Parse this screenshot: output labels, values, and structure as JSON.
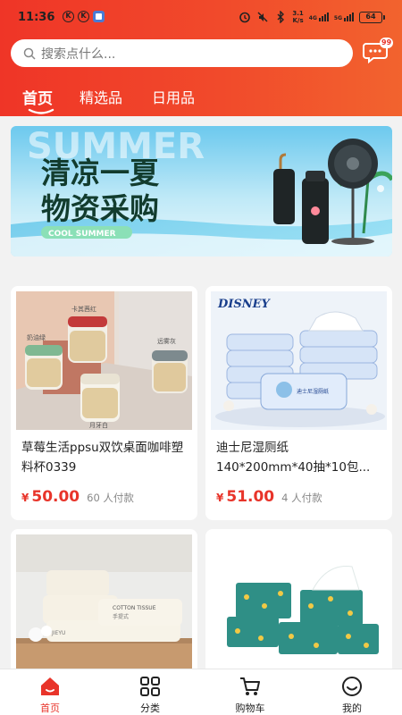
{
  "status_bar": {
    "time": "11:36",
    "speed_value": "3.1",
    "speed_unit": "K/s",
    "net1": "4G",
    "net2": "5G",
    "battery": "64"
  },
  "search": {
    "placeholder": "搜索点什么...",
    "message_badge": "99"
  },
  "tabs": [
    {
      "label": "首页",
      "active": true
    },
    {
      "label": "精选品",
      "active": false
    },
    {
      "label": "日用品",
      "active": false
    }
  ],
  "banner": {
    "headline_line1": "清凉一夏",
    "headline_line2": "物资采购",
    "tag": "COOL SUMMER",
    "bg_word": "SUMMER"
  },
  "products": [
    {
      "title": "草莓生活ppsu双饮桌面咖啡塑料杯0339",
      "currency": "¥",
      "price": "50.00",
      "sold": "60 人付款",
      "image_labels": [
        "奶油绿",
        "卡其茜红",
        "远雾灰",
        "月牙白"
      ]
    },
    {
      "title": "迪士尼湿厕纸140*200mm*40抽*10包...",
      "currency": "¥",
      "price": "51.00",
      "sold": "4 人付款",
      "brand_logo": "DISNEY",
      "pack_text": "迪士尼湿厕纸"
    },
    {
      "title": "",
      "pack_text": "COTTON TISSUE",
      "pack_sub": "手提式",
      "brand": "JIEYU"
    },
    {
      "title": ""
    }
  ],
  "bottom_nav": [
    {
      "label": "首页",
      "icon": "home-icon",
      "active": true
    },
    {
      "label": "分类",
      "icon": "category-icon",
      "active": false
    },
    {
      "label": "购物车",
      "icon": "cart-icon",
      "active": false
    },
    {
      "label": "我的",
      "icon": "profile-icon",
      "active": false
    }
  ],
  "colors": {
    "brand_red": "#ee3b2a",
    "price_red": "#e8342a"
  }
}
